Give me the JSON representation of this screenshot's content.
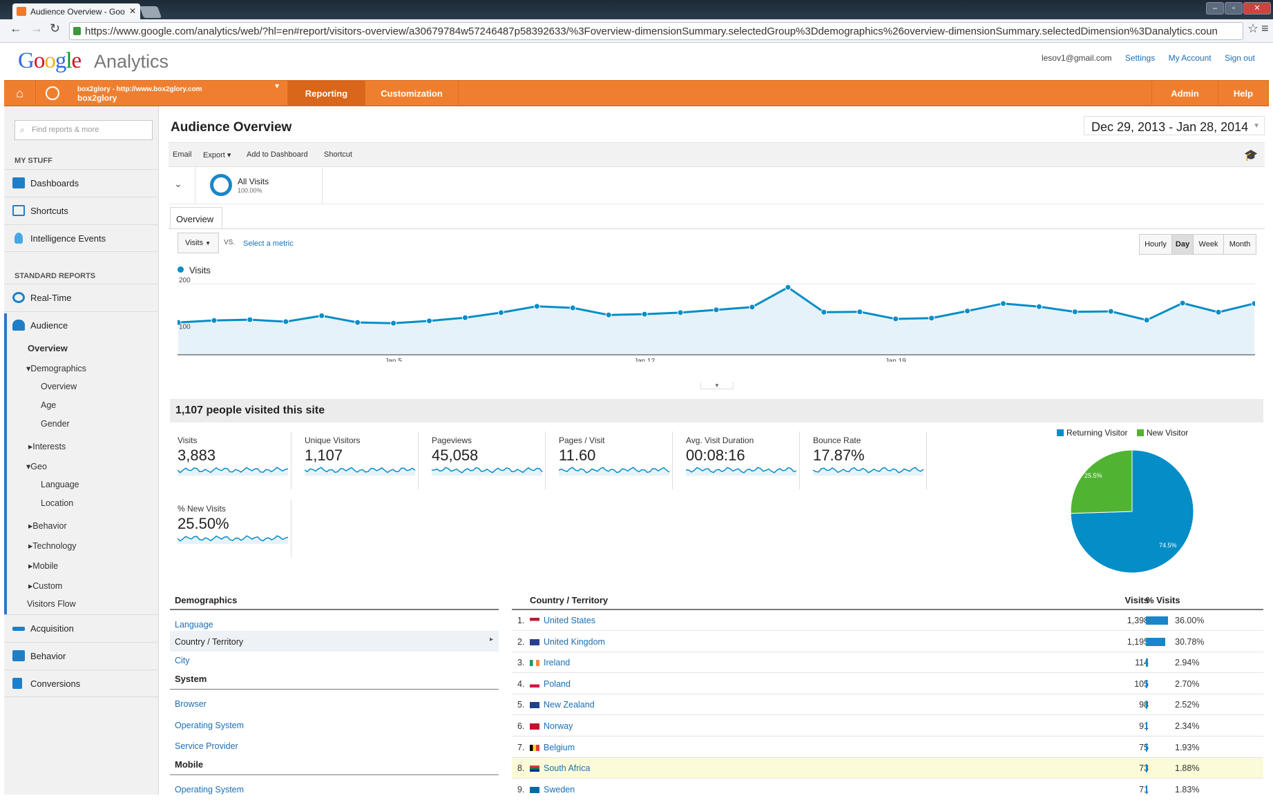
{
  "browser": {
    "tab_title": "Audience Overview - Goo",
    "url": "https://www.google.com/analytics/web/?hl=en#report/visitors-overview/a30679784w57246487p58392633/%3Foverview-dimensionSummary.selectedGroup%3Ddemographics%26overview-dimensionSummary.selectedDimension%3Danalytics.coun"
  },
  "header": {
    "logo": "Google",
    "product": "Analytics",
    "email": "lesov1@gmail.com",
    "settings": "Settings",
    "my_account": "My Account",
    "sign_out": "Sign out"
  },
  "nav": {
    "account_url": "box2glory - http://www.box2glory.com",
    "account_name": "box2glory",
    "reporting": "Reporting",
    "customization": "Customization",
    "admin": "Admin",
    "help": "Help"
  },
  "sidebar": {
    "search_placeholder": "Find reports & more",
    "my_stuff": "MY STUFF",
    "dashboards": "Dashboards",
    "shortcuts": "Shortcuts",
    "intelligence": "Intelligence Events",
    "standard": "STANDARD REPORTS",
    "realtime": "Real-Time",
    "audience": "Audience",
    "overview": "Overview",
    "demographics": "Demographics",
    "demo_overview": "Overview",
    "age": "Age",
    "gender": "Gender",
    "interests": "Interests",
    "geo": "Geo",
    "language": "Language",
    "location": "Location",
    "behavior": "Behavior",
    "technology": "Technology",
    "mobile": "Mobile",
    "custom": "Custom",
    "visitors_flow": "Visitors Flow",
    "acquisition": "Acquisition",
    "behavior_main": "Behavior",
    "conversions": "Conversions"
  },
  "report": {
    "title": "Audience Overview",
    "date_range": "Dec 29, 2013 - Jan 28, 2014",
    "toolbar": [
      "Email",
      "Export",
      "Add to Dashboard",
      "Shortcut"
    ],
    "segment_name": "All Visits",
    "segment_pct": "100.00%",
    "tab": "Overview",
    "metric": "Visits",
    "vs": "VS.",
    "select_metric": "Select a metric",
    "granularity": [
      "Hourly",
      "Day",
      "Week",
      "Month"
    ],
    "summary": "1,107 people visited this site"
  },
  "chart_data": {
    "type": "area",
    "series": [
      {
        "name": "Visits",
        "values": [
          102,
          107,
          109,
          104,
          119,
          102,
          100,
          106,
          114,
          127,
          143,
          139,
          121,
          123,
          127,
          134,
          141,
          191,
          128,
          129,
          111,
          113,
          131,
          150,
          142,
          129,
          130,
          108,
          151,
          128,
          150
        ]
      }
    ],
    "y_ticks": [
      "200",
      "100"
    ],
    "x_ticks": [
      "Jan 5",
      "Jan 12",
      "Jan 19"
    ],
    "ylim": [
      20,
      230
    ]
  },
  "metrics": [
    {
      "label": "Visits",
      "value": "3,883"
    },
    {
      "label": "Unique Visitors",
      "value": "1,107"
    },
    {
      "label": "Pageviews",
      "value": "45,058"
    },
    {
      "label": "Pages / Visit",
      "value": "11.60"
    },
    {
      "label": "Avg. Visit Duration",
      "value": "00:08:16"
    },
    {
      "label": "Bounce Rate",
      "value": "17.87%"
    },
    {
      "label": "% New Visits",
      "value": "25.50%"
    }
  ],
  "pie": {
    "legend": [
      "Returning Visitor",
      "New Visitor"
    ],
    "returning_pct": "74.5%",
    "new_pct": "25.5%",
    "returning_value": 74.5,
    "colors": [
      "#058dc7",
      "#50b432"
    ]
  },
  "dimensions": {
    "demographics": "Demographics",
    "language": "Language",
    "country": "Country / Territory",
    "city": "City",
    "system": "System",
    "browser": "Browser",
    "os": "Operating System",
    "provider": "Service Provider",
    "mobile": "Mobile",
    "mobile_os": "Operating System"
  },
  "country_table": {
    "header_dim": "Country / Territory",
    "header_visits": "Visits",
    "header_pct": "% Visits",
    "rows": [
      {
        "rank": "1.",
        "name": "United States",
        "visits": "1,398",
        "pct": "36.00%",
        "share": 36.0
      },
      {
        "rank": "2.",
        "name": "United Kingdom",
        "visits": "1,195",
        "pct": "30.78%",
        "share": 30.78
      },
      {
        "rank": "3.",
        "name": "Ireland",
        "visits": "114",
        "pct": "2.94%",
        "share": 2.94
      },
      {
        "rank": "4.",
        "name": "Poland",
        "visits": "105",
        "pct": "2.70%",
        "share": 2.7
      },
      {
        "rank": "5.",
        "name": "New Zealand",
        "visits": "98",
        "pct": "2.52%",
        "share": 2.52
      },
      {
        "rank": "6.",
        "name": "Norway",
        "visits": "91",
        "pct": "2.34%",
        "share": 2.34
      },
      {
        "rank": "7.",
        "name": "Belgium",
        "visits": "75",
        "pct": "1.93%",
        "share": 1.93
      },
      {
        "rank": "8.",
        "name": "South Africa",
        "visits": "73",
        "pct": "1.88%",
        "share": 1.88
      },
      {
        "rank": "9.",
        "name": "Sweden",
        "visits": "71",
        "pct": "1.83%",
        "share": 1.83
      }
    ]
  }
}
